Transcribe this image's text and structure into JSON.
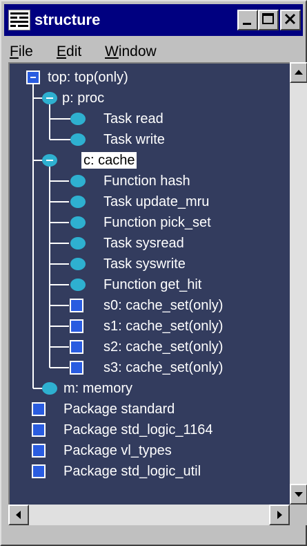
{
  "window": {
    "title": "structure",
    "icon": "structure-app-icon"
  },
  "menu": {
    "file": {
      "prefix": "",
      "accel": "F",
      "rest": "ile"
    },
    "edit": {
      "prefix": "",
      "accel": "E",
      "rest": "dit"
    },
    "window": {
      "prefix": "",
      "accel": "W",
      "rest": "indow"
    }
  },
  "tree": {
    "nodes": [
      {
        "label": "top: top(only)",
        "icon": "module-square-icon",
        "expander": "minus"
      },
      {
        "label": "p: proc",
        "icon": "expanded-oval-icon"
      },
      {
        "label": "Task read",
        "icon": "oval-icon"
      },
      {
        "label": "Task write",
        "icon": "oval-icon"
      },
      {
        "label": "c: cache",
        "icon": "expanded-oval-icon",
        "selected": true
      },
      {
        "label": "Function hash",
        "icon": "oval-icon"
      },
      {
        "label": "Task update_mru",
        "icon": "oval-icon"
      },
      {
        "label": "Function pick_set",
        "icon": "oval-icon"
      },
      {
        "label": "Task sysread",
        "icon": "oval-icon"
      },
      {
        "label": "Task syswrite",
        "icon": "oval-icon"
      },
      {
        "label": "Function get_hit",
        "icon": "oval-icon"
      },
      {
        "label": "s0: cache_set(only)",
        "icon": "module-square-icon"
      },
      {
        "label": "s1: cache_set(only)",
        "icon": "module-square-icon"
      },
      {
        "label": "s2: cache_set(only)",
        "icon": "module-square-icon"
      },
      {
        "label": "s3: cache_set(only)",
        "icon": "module-square-icon"
      },
      {
        "label": "m: memory",
        "icon": "oval-icon"
      },
      {
        "label": "Package standard",
        "icon": "module-square-icon"
      },
      {
        "label": "Package std_logic_1164",
        "icon": "module-square-icon"
      },
      {
        "label": "Package vl_types",
        "icon": "module-square-icon"
      },
      {
        "label": "Package std_logic_util",
        "icon": "module-square-icon"
      }
    ]
  },
  "colors": {
    "titlebar": "#000080",
    "tree_bg": "#333c5e",
    "node_fill": "#2a5ce0",
    "oval_fill": "#2eb0d0",
    "selection_bg": "#ffffff"
  }
}
